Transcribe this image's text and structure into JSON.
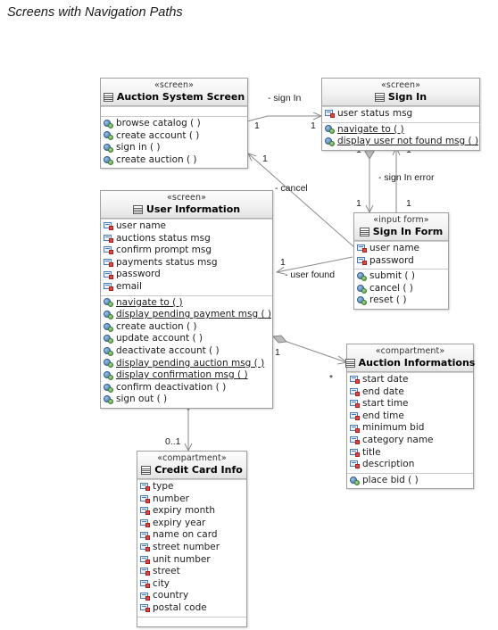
{
  "title": "Screens with Navigation Paths",
  "icons": {
    "class": "screen-window-icon",
    "attribute": "private-attribute-icon",
    "operation": "public-operation-icon"
  },
  "classes": [
    {
      "id": "auction-system-screen",
      "stereotype": "«screen»",
      "name": "Auction System Screen",
      "attributes": [],
      "operations": [
        {
          "label": "browse catalog ( )",
          "static": false
        },
        {
          "label": "create account ( )",
          "static": false
        },
        {
          "label": "sign in ( )",
          "static": false
        },
        {
          "label": "create auction ( )",
          "static": false
        }
      ]
    },
    {
      "id": "sign-in",
      "stereotype": "«screen»",
      "name": "Sign In",
      "attributes": [
        {
          "label": "user status msg"
        }
      ],
      "operations": [
        {
          "label": "navigate to ( )",
          "static": true
        },
        {
          "label": "display user not found msg ( )",
          "static": true
        }
      ]
    },
    {
      "id": "user-information",
      "stereotype": "«screen»",
      "name": "User Information",
      "attributes": [
        {
          "label": "user name"
        },
        {
          "label": "auctions status msg"
        },
        {
          "label": "confirm prompt msg"
        },
        {
          "label": "payments status msg"
        },
        {
          "label": "password"
        },
        {
          "label": "email"
        }
      ],
      "operations": [
        {
          "label": "navigate to ( )",
          "static": true
        },
        {
          "label": "display pending payment msg ( )",
          "static": true
        },
        {
          "label": "create auction ( )",
          "static": false
        },
        {
          "label": "update account ( )",
          "static": false
        },
        {
          "label": "deactivate account ( )",
          "static": false
        },
        {
          "label": "display pending auction msg ( )",
          "static": true
        },
        {
          "label": "display confirmation msg ( )",
          "static": true
        },
        {
          "label": "confirm deactivation ( )",
          "static": false
        },
        {
          "label": "sign out ( )",
          "static": false
        }
      ]
    },
    {
      "id": "sign-in-form",
      "stereotype": "«input form»",
      "name": "Sign In Form",
      "attributes": [
        {
          "label": "user name"
        },
        {
          "label": "password"
        }
      ],
      "operations": [
        {
          "label": "submit ( )",
          "static": false
        },
        {
          "label": "cancel ( )",
          "static": false
        },
        {
          "label": "reset ( )",
          "static": false
        }
      ]
    },
    {
      "id": "auction-informations",
      "stereotype": "«compartment»",
      "name": "Auction Informations",
      "attributes": [
        {
          "label": "start date"
        },
        {
          "label": "end date"
        },
        {
          "label": "start time"
        },
        {
          "label": "end time"
        },
        {
          "label": "minimum bid"
        },
        {
          "label": "category name"
        },
        {
          "label": "title"
        },
        {
          "label": "description"
        }
      ],
      "operations": [
        {
          "label": "place bid ( )",
          "static": false
        }
      ]
    },
    {
      "id": "credit-card-info",
      "stereotype": "«compartment»",
      "name": "Credit Card Info",
      "attributes": [
        {
          "label": "type"
        },
        {
          "label": "number"
        },
        {
          "label": "expiry month"
        },
        {
          "label": "expiry year"
        },
        {
          "label": "name on card"
        },
        {
          "label": "street number"
        },
        {
          "label": "unit number"
        },
        {
          "label": "street"
        },
        {
          "label": "city"
        },
        {
          "label": "country"
        },
        {
          "label": "postal code"
        }
      ],
      "operations": []
    }
  ],
  "relationships": [
    {
      "id": "sign-in-path",
      "label": "- sign In",
      "source_multiplicity": "1",
      "target_multiplicity": "1"
    },
    {
      "id": "cancel-path",
      "label": "- cancel",
      "source_multiplicity": "1",
      "target_multiplicity": "1"
    },
    {
      "id": "sign-in-error-path",
      "label": "- sign In error",
      "source_multiplicity": "1",
      "target_multiplicity": "1"
    },
    {
      "id": "user-found-path",
      "label": "- user found",
      "source_multiplicity": "1",
      "target_multiplicity": "1"
    },
    {
      "id": "sign-in-form-aggregation",
      "label": "",
      "source_multiplicity": "1",
      "target_multiplicity": "1"
    },
    {
      "id": "auction-informations-aggregation",
      "label": "",
      "source_multiplicity": "1",
      "target_multiplicity": "*"
    },
    {
      "id": "credit-card-aggregation",
      "label": "",
      "source_multiplicity": "1",
      "target_multiplicity": "0..1"
    }
  ],
  "multiplicity_markers": [
    {
      "id": "m-asc-signin-src",
      "value": "1"
    },
    {
      "id": "m-signin-tgt",
      "value": "1"
    },
    {
      "id": "m-asc-cancel-src",
      "value": "1"
    },
    {
      "id": "m-cancel-tgt",
      "value": "1"
    },
    {
      "id": "m-signin-agg-top",
      "value": "1"
    },
    {
      "id": "m-signin-err-top",
      "value": "1"
    },
    {
      "id": "m-signin-agg-bottom",
      "value": "1"
    },
    {
      "id": "m-signin-err-bottom",
      "value": "1"
    },
    {
      "id": "m-userfound-src",
      "value": "1"
    },
    {
      "id": "m-auctioninfo-src",
      "value": "1"
    },
    {
      "id": "m-auctioninfo-tgt",
      "value": "*"
    },
    {
      "id": "m-creditcard-src",
      "value": "1"
    },
    {
      "id": "m-creditcard-tgt",
      "value": "0..1"
    }
  ]
}
